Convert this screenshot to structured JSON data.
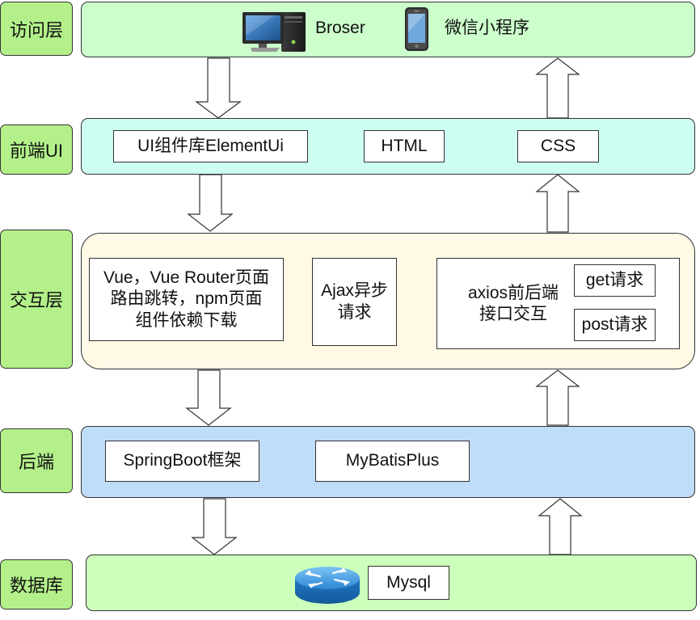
{
  "layers": {
    "access": "访问层",
    "frontend": "前端UI",
    "interaction": "交互层",
    "backend": "后端",
    "database": "数据库"
  },
  "access": {
    "browser_label": "Broser",
    "miniprogram_label": "微信小程序"
  },
  "frontend": {
    "ui_lib": "UI组件库ElementUi",
    "html": "HTML",
    "css": "CSS"
  },
  "interaction": {
    "vue_line1": "Vue，Vue Router页面",
    "vue_line2": "路由跳转，npm页面",
    "vue_line3": "组件依赖下载",
    "ajax_line1": "Ajax异步",
    "ajax_line2": "请求",
    "axios_line1": "axios前后端",
    "axios_line2": "接口交互",
    "get": "get请求",
    "post": "post请求"
  },
  "backend": {
    "springboot": "SpringBoot框架",
    "mybatisplus": "MyBatisPlus"
  },
  "database": {
    "mysql": "Mysql"
  },
  "colors": {
    "layer_label": "#b3f08a",
    "access_panel": "#ccffcc",
    "frontend_panel": "#ccfff2",
    "interaction_panel": "#fff9e6",
    "backend_panel": "#bfdcf9",
    "database_panel": "#ccffbb"
  },
  "icons": [
    "desktop-computer-icon",
    "mobile-phone-icon",
    "router-icon"
  ]
}
